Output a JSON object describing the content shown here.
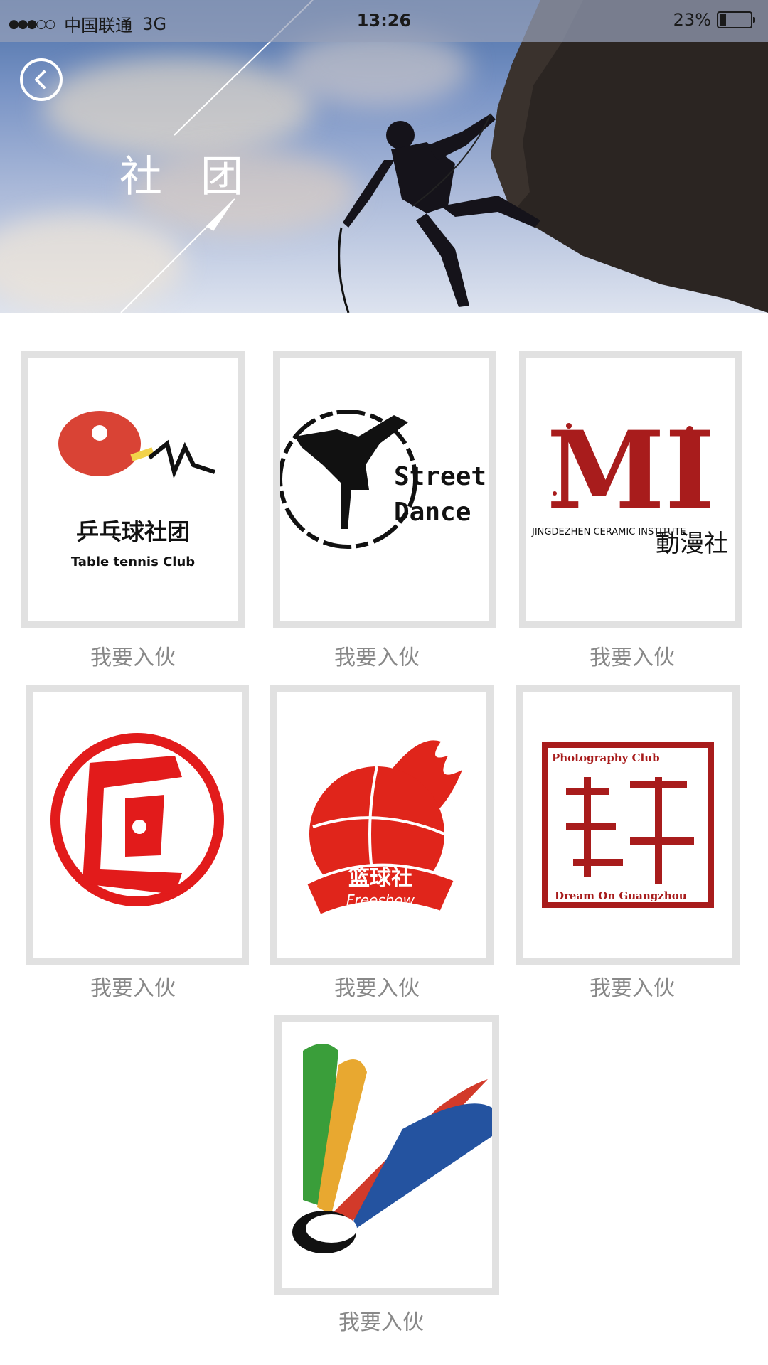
{
  "status_bar": {
    "carrier": "中国联通",
    "network": "3G",
    "time": "13:26",
    "battery": "23%",
    "battery_level": 0.23
  },
  "header": {
    "title": "社团"
  },
  "clubs": [
    {
      "id": "table-tennis",
      "logo_text": "乒乓球社团",
      "logo_subtext": "Table tennis Club",
      "action": "我要入伙"
    },
    {
      "id": "street-dance",
      "logo_text": "Street",
      "logo_subtext": "Dance",
      "action": "我要入伙"
    },
    {
      "id": "anime",
      "logo_text": "MI",
      "logo_subtext": "JINGDEZHEN CERAMIC INSTITUTE",
      "logo_subtext2": "動漫社",
      "action": "我要入伙"
    },
    {
      "id": "seal",
      "action": "我要入伙"
    },
    {
      "id": "basketball",
      "logo_text": "篮球社",
      "logo_subtext": "Freeshow",
      "action": "我要入伙"
    },
    {
      "id": "photography",
      "logo_text": "Photography Club",
      "logo_subtext": "Dream On Guangzhou",
      "action": "我要入伙"
    },
    {
      "id": "badminton",
      "action": "我要入伙"
    }
  ],
  "colors": {
    "card_border": "#e1e1e1",
    "action_text": "#888888",
    "accent_red": "#c81e1e"
  }
}
